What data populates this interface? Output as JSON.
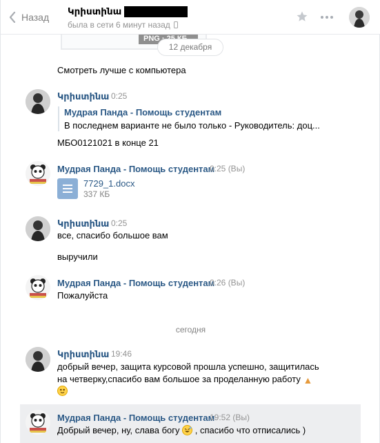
{
  "header": {
    "back_label": "Назад",
    "chat_name": "Կրիստինա",
    "status": "была в сети 6 минут назад"
  },
  "previous": {
    "file_badge": "PNG · 25 КБ",
    "date_divider": "12 декабря",
    "text": "Смотреть лучше с компьютера"
  },
  "messages": [
    {
      "sender": "Կրիստինա",
      "time": "0:25",
      "forward": {
        "name": "Мудрая Панда - Помощь студентам",
        "text": "В последнем варианте не было только - Руководитель: доц..."
      },
      "text": "МБО0121021 в конце 21"
    },
    {
      "sender": "Мудрая Панда - Помощь студентам",
      "time": "0:25 (Вы)",
      "doc": {
        "name": "7729_1.docx",
        "size": "337 КБ"
      }
    },
    {
      "sender": "Կրիստինա",
      "time": "0:25",
      "lines": [
        "все, спасибо большое вам",
        "выручили"
      ]
    },
    {
      "sender": "Мудрая Панда - Помощь студентам",
      "time": "0:26 (Вы)",
      "text": "Пожалуйста"
    },
    {
      "sender": "Կրիստինա",
      "time": "19:46",
      "line1": "добрый вечер, защита курсовой прошла успешно, защитилась",
      "line2": "на четверку,спасибо вам большое за проделанную работу"
    },
    {
      "sender": "Мудрая Панда - Помощь студентам",
      "time": "19:52 (Вы)",
      "text_before": "Добрый вечер, ну, слава богу",
      "text_after": ", спасибо что отписались )"
    }
  ],
  "day_divider": "сегодня",
  "colors": {
    "link": "#2a5885",
    "muted": "#939393",
    "highlight": "#edeef0",
    "doc_icon": "#8bafd6"
  },
  "icons": [
    "chevron-left-icon",
    "star-icon",
    "more-icon",
    "phone-icon",
    "document-icon",
    "pray-hands-emoji",
    "smile-emoji",
    "grinning-sweat-emoji"
  ]
}
